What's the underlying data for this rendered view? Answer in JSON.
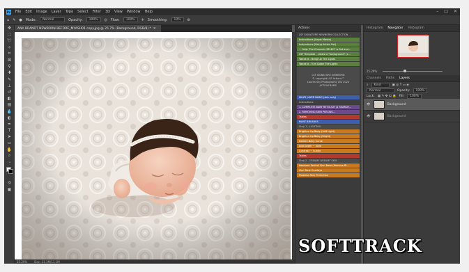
{
  "menu": {
    "items": [
      "File",
      "Edit",
      "Image",
      "Layer",
      "Type",
      "Select",
      "Filter",
      "3D",
      "View",
      "Window",
      "Help"
    ]
  },
  "options": {
    "mode_label": "Mode:",
    "mode": "Normal",
    "opacity_label": "Opacity:",
    "opacity": "100%",
    "flow_label": "Flow:",
    "flow": "100%",
    "smoothing_label": "Smoothing:",
    "smoothing": "10%"
  },
  "document": {
    "tab": "ANA BRANDT NEWBORN BEFORE_MYASH01 copy.jpg @ 25.7% (Background, RGB/8) *",
    "zoom": "25.29%",
    "doc_size": "Doc: 11.1M/11.1M"
  },
  "actions": {
    "title": "Actions",
    "items": [
      {
        "label": "LSF SIGNATURE NEWBORN COLLECTION ...",
        "c": "d"
      },
      {
        "label": "Instructions (Layer Masks)",
        "c": "g"
      },
      {
        "label": "Instructions (Using Action Set)",
        "c": "g"
      },
      {
        "label": "~ Help: The Channels SELECT is Set and...",
        "c": "g"
      },
      {
        "label": "LSF Template - create a \"background\" (c...",
        "c": "g"
      },
      {
        "label": "Tweak It - Bring Up The Lights",
        "c": "g"
      },
      {
        "label": "Tweak It - Turn Down The Lights",
        "c": "g"
      }
    ],
    "info1": [
      "LSF SIGNATURE NEWBORN",
      "© copyright LSF Actions™",
      "Lauren Sky Photography LTD 2020",
      "ACTION BABY!"
    ],
    "items2": [
      {
        "label": "MULTI LAYER BASIC (skin only)",
        "c": "b"
      },
      {
        "label": "Instructions",
        "c": "d"
      },
      {
        "label": "1. COMPLETE BABY RETOUCH (1 SEARCH...",
        "c": "p"
      },
      {
        "label": "2. REMOVING SKIN PEELING...",
        "c": "p"
      },
      {
        "label": "Tables",
        "c": "r"
      },
      {
        "label": "PAINT BRUSHES",
        "c": "b"
      },
      {
        "label": "Step 1 - LIGHTING",
        "c": "t"
      },
      {
        "label": "Brighten Up Baby (Soft Light)",
        "c": "o"
      },
      {
        "label": "Brighten Up Baby (Bright)",
        "c": "o"
      },
      {
        "label": "Darken Baby Curve",
        "c": "o"
      },
      {
        "label": "Add Depth ~ Vivid",
        "c": "o"
      },
      {
        "label": "Contrast ~ Subtle",
        "c": "o"
      },
      {
        "label": "Tables",
        "c": "r"
      },
      {
        "label": "Step 2 - CREAMY DREAMY SKIN",
        "c": "t"
      },
      {
        "label": "Newborn Perfect Skin Base (Remove Bl...",
        "c": "o"
      },
      {
        "label": "Skin Tone Overlays",
        "c": "o"
      },
      {
        "label": "Flawless Skin Perfection",
        "c": "o"
      }
    ]
  },
  "right": {
    "tabs": [
      "Histogram",
      "Navigator",
      "Histogram"
    ],
    "nav_zoom": "25.29%",
    "layer_tabs": [
      "Channels",
      "Paths",
      "Layers"
    ],
    "kind": "Kind",
    "blend": "Normal",
    "opacity_label": "Opacity:",
    "opacity": "100%",
    "lock_label": "Lock:",
    "fill_label": "Fill:",
    "fill": "100%",
    "layers": [
      "Background",
      "Background"
    ]
  },
  "watermark": "SOFTTRACK"
}
